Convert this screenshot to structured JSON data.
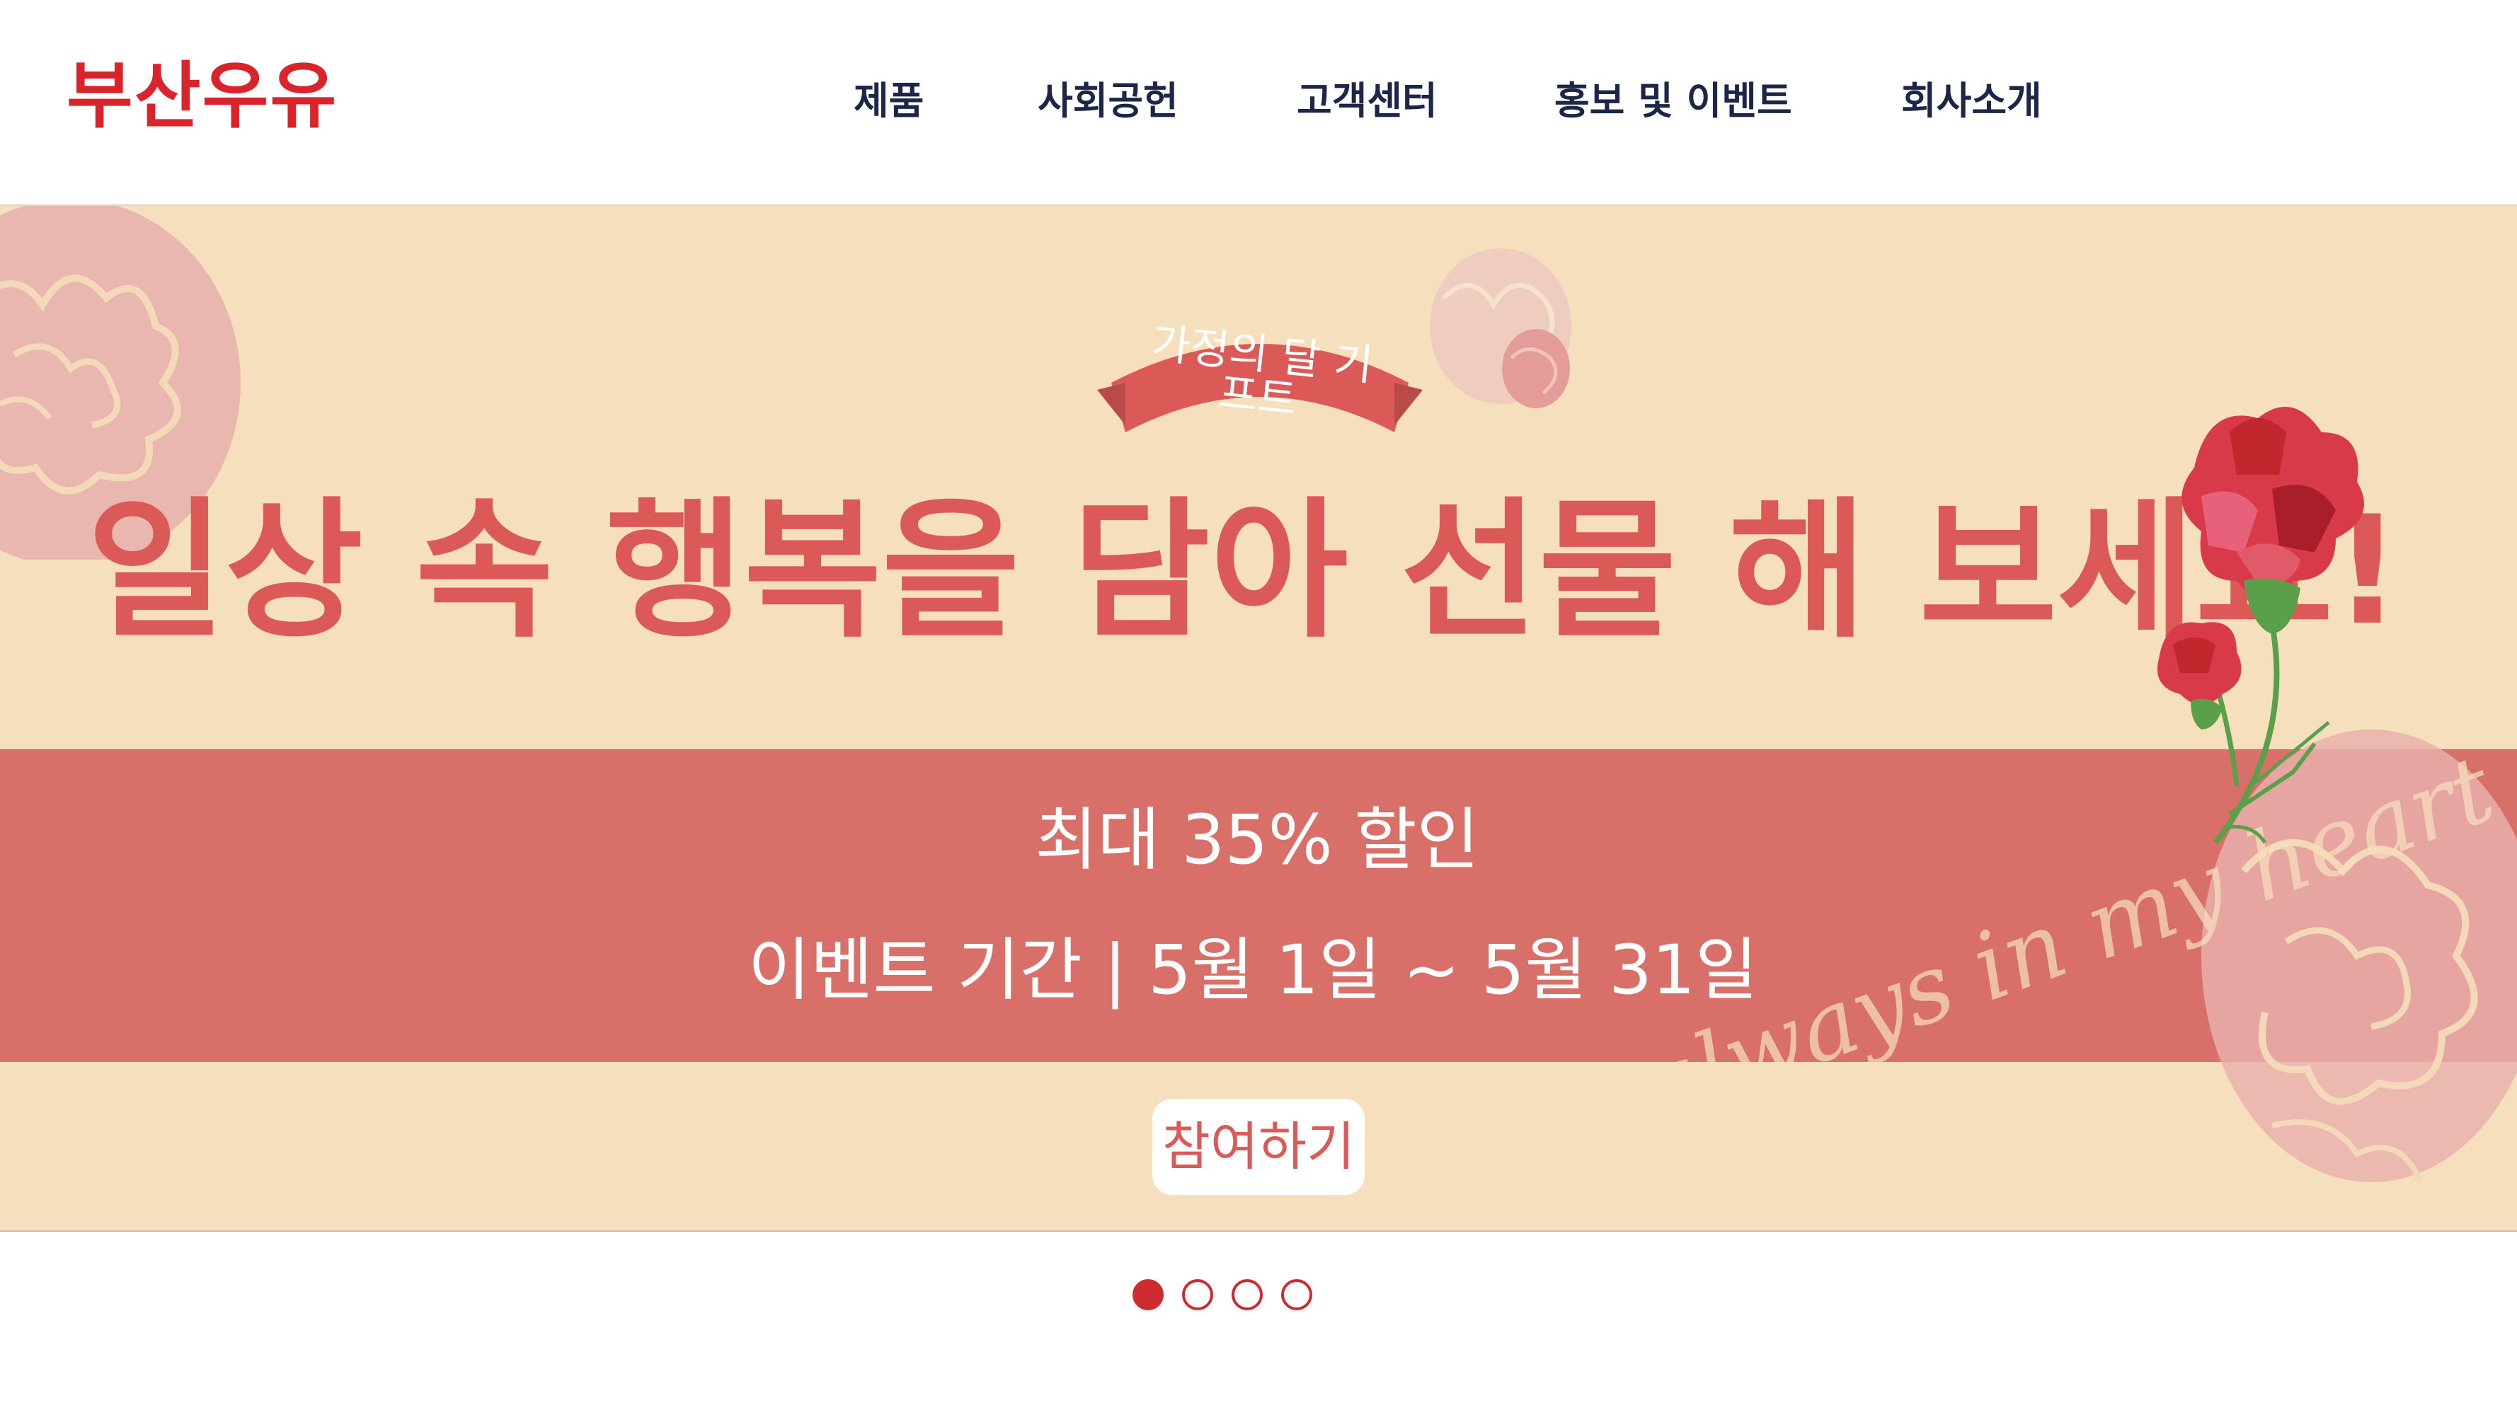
{
  "header": {
    "logo": "부산우유",
    "nav": [
      {
        "label": "제품"
      },
      {
        "label": "사회공헌"
      },
      {
        "label": "고객센터"
      },
      {
        "label": "홍보 및 이벤트"
      },
      {
        "label": "회사소개"
      }
    ]
  },
  "banner": {
    "ribbon": "가정의 달 기프트",
    "headline": "일상 속 행복을 담아 선물 해 보세요!",
    "discount": "최대 35% 할인",
    "period": "이벤트 기간 | 5월 1일 ~ 5월 31일",
    "cta": "참여하기",
    "script_text": "always in my heart"
  },
  "carousel": {
    "total": 4,
    "active_index": 0
  },
  "colors": {
    "brand": "#d8242a",
    "nav_text": "#1c2647",
    "banner_bg": "#f6dfbd",
    "stripe": "#d87069",
    "headline": "#db5a58",
    "dot": "#cf2b2f"
  }
}
